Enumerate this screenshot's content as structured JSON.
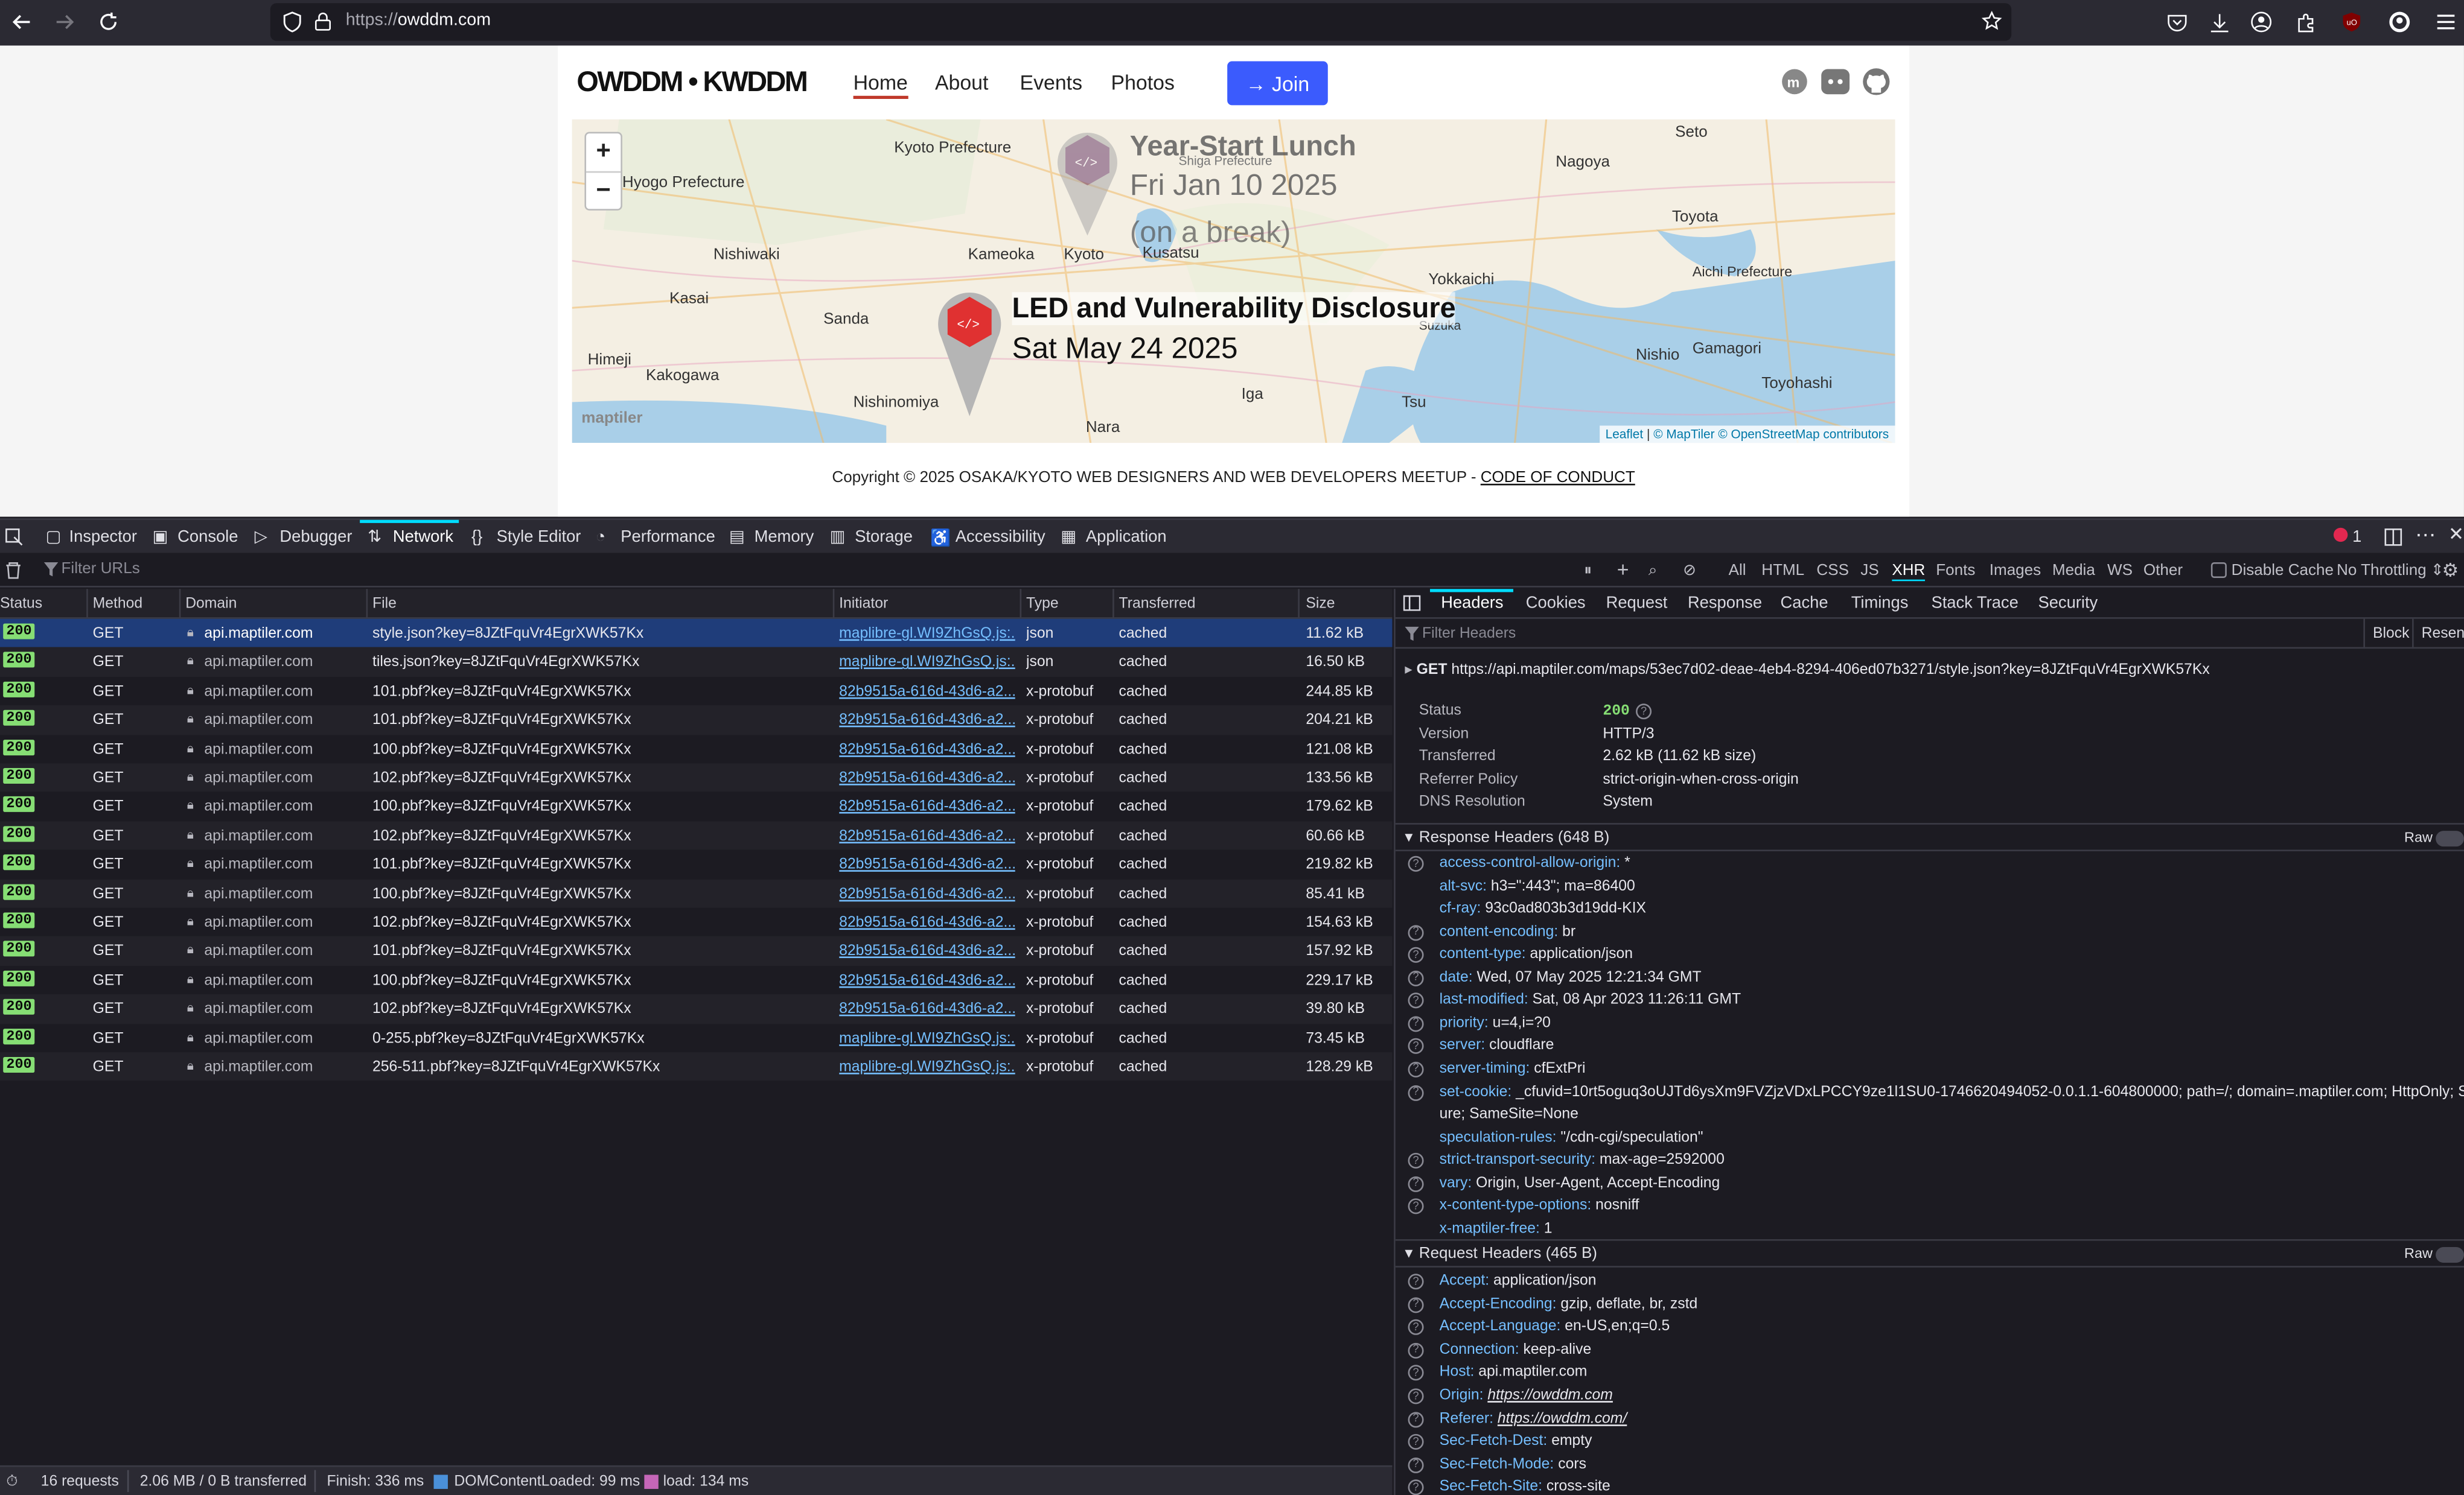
{
  "browser": {
    "url_scheme": "https://",
    "url_host": "owddm.com"
  },
  "site": {
    "logo": "OWDDM • KWDDM",
    "nav": [
      "Home",
      "About",
      "Events",
      "Photos"
    ],
    "join": "→ Join",
    "map": {
      "cities": [
        "Seto",
        "Kyoto Prefecture",
        "Hyogo Prefecture",
        "Shiga Prefecture",
        "Nagoya",
        "Toyota",
        "Nishiwaki",
        "Kameoka",
        "Kyoto",
        "Kusatsu",
        "Yokkaichi",
        "Aichi Prefecture",
        "Kasai",
        "Sanda",
        "Suzuka",
        "Himeji",
        "Kakogawa",
        "Nishio",
        "Gamagori",
        "Toyohashi",
        "Nishinomiya",
        "Iga",
        "Tsu",
        "Nara"
      ],
      "event1": {
        "title": "Year-Start Lunch",
        "date": "Fri Jan 10 2025",
        "note": "(on a break)"
      },
      "event2": {
        "title": "LED and Vulnerability Disclosure",
        "date": "Sat May 24 2025"
      },
      "attribution": {
        "leaflet": "Leaflet",
        "sep": " | ",
        "maptiler": "© MapTiler",
        "osm": "© OpenStreetMap contributors"
      },
      "maptiler_logo": "maptiler"
    },
    "copyright": "Copyright © 2025 OSAKA/KYOTO WEB DESIGNERS AND WEB DEVELOPERS MEETUP - ",
    "code_of_conduct": "CODE OF CONDUCT"
  },
  "devtools": {
    "tabs": [
      "Inspector",
      "Console",
      "Debugger",
      "Network",
      "Style Editor",
      "Performance",
      "Memory",
      "Storage",
      "Accessibility",
      "Application"
    ],
    "error_count": "1",
    "filter_placeholder": "Filter URLs",
    "types": [
      "All",
      "HTML",
      "CSS",
      "JS",
      "XHR",
      "Fonts",
      "Images",
      "Media",
      "WS",
      "Other"
    ],
    "disable_cache": "Disable Cache",
    "throttling": "No Throttling ⇕",
    "columns": [
      "Status",
      "Method",
      "Domain",
      "File",
      "Initiator",
      "Type",
      "Transferred",
      "Size"
    ],
    "requests": [
      {
        "status": "200",
        "method": "GET",
        "domain": "api.maptiler.com",
        "file": "style.json?key=8JZtFquVr4EgrXWK57Kx",
        "initiator": "maplibre-gl.WI9ZhGsQ.js:...",
        "type": "json",
        "transferred": "cached",
        "size": "11.62 kB"
      },
      {
        "status": "200",
        "method": "GET",
        "domain": "api.maptiler.com",
        "file": "tiles.json?key=8JZtFquVr4EgrXWK57Kx",
        "initiator": "maplibre-gl.WI9ZhGsQ.js:...",
        "type": "json",
        "transferred": "cached",
        "size": "16.50 kB"
      },
      {
        "status": "200",
        "method": "GET",
        "domain": "api.maptiler.com",
        "file": "101.pbf?key=8JZtFquVr4EgrXWK57Kx",
        "initiator": "82b9515a-616d-43d6-a2...",
        "type": "x-protobuf",
        "transferred": "cached",
        "size": "244.85 kB"
      },
      {
        "status": "200",
        "method": "GET",
        "domain": "api.maptiler.com",
        "file": "101.pbf?key=8JZtFquVr4EgrXWK57Kx",
        "initiator": "82b9515a-616d-43d6-a2...",
        "type": "x-protobuf",
        "transferred": "cached",
        "size": "204.21 kB"
      },
      {
        "status": "200",
        "method": "GET",
        "domain": "api.maptiler.com",
        "file": "100.pbf?key=8JZtFquVr4EgrXWK57Kx",
        "initiator": "82b9515a-616d-43d6-a2...",
        "type": "x-protobuf",
        "transferred": "cached",
        "size": "121.08 kB"
      },
      {
        "status": "200",
        "method": "GET",
        "domain": "api.maptiler.com",
        "file": "102.pbf?key=8JZtFquVr4EgrXWK57Kx",
        "initiator": "82b9515a-616d-43d6-a2...",
        "type": "x-protobuf",
        "transferred": "cached",
        "size": "133.56 kB"
      },
      {
        "status": "200",
        "method": "GET",
        "domain": "api.maptiler.com",
        "file": "100.pbf?key=8JZtFquVr4EgrXWK57Kx",
        "initiator": "82b9515a-616d-43d6-a2...",
        "type": "x-protobuf",
        "transferred": "cached",
        "size": "179.62 kB"
      },
      {
        "status": "200",
        "method": "GET",
        "domain": "api.maptiler.com",
        "file": "102.pbf?key=8JZtFquVr4EgrXWK57Kx",
        "initiator": "82b9515a-616d-43d6-a2...",
        "type": "x-protobuf",
        "transferred": "cached",
        "size": "60.66 kB"
      },
      {
        "status": "200",
        "method": "GET",
        "domain": "api.maptiler.com",
        "file": "101.pbf?key=8JZtFquVr4EgrXWK57Kx",
        "initiator": "82b9515a-616d-43d6-a2...",
        "type": "x-protobuf",
        "transferred": "cached",
        "size": "219.82 kB"
      },
      {
        "status": "200",
        "method": "GET",
        "domain": "api.maptiler.com",
        "file": "100.pbf?key=8JZtFquVr4EgrXWK57Kx",
        "initiator": "82b9515a-616d-43d6-a2...",
        "type": "x-protobuf",
        "transferred": "cached",
        "size": "85.41 kB"
      },
      {
        "status": "200",
        "method": "GET",
        "domain": "api.maptiler.com",
        "file": "102.pbf?key=8JZtFquVr4EgrXWK57Kx",
        "initiator": "82b9515a-616d-43d6-a2...",
        "type": "x-protobuf",
        "transferred": "cached",
        "size": "154.63 kB"
      },
      {
        "status": "200",
        "method": "GET",
        "domain": "api.maptiler.com",
        "file": "101.pbf?key=8JZtFquVr4EgrXWK57Kx",
        "initiator": "82b9515a-616d-43d6-a2...",
        "type": "x-protobuf",
        "transferred": "cached",
        "size": "157.92 kB"
      },
      {
        "status": "200",
        "method": "GET",
        "domain": "api.maptiler.com",
        "file": "100.pbf?key=8JZtFquVr4EgrXWK57Kx",
        "initiator": "82b9515a-616d-43d6-a2...",
        "type": "x-protobuf",
        "transferred": "cached",
        "size": "229.17 kB"
      },
      {
        "status": "200",
        "method": "GET",
        "domain": "api.maptiler.com",
        "file": "102.pbf?key=8JZtFquVr4EgrXWK57Kx",
        "initiator": "82b9515a-616d-43d6-a2...",
        "type": "x-protobuf",
        "transferred": "cached",
        "size": "39.80 kB"
      },
      {
        "status": "200",
        "method": "GET",
        "domain": "api.maptiler.com",
        "file": "0-255.pbf?key=8JZtFquVr4EgrXWK57Kx",
        "initiator": "maplibre-gl.WI9ZhGsQ.js:...",
        "type": "x-protobuf",
        "transferred": "cached",
        "size": "73.45 kB"
      },
      {
        "status": "200",
        "method": "GET",
        "domain": "api.maptiler.com",
        "file": "256-511.pbf?key=8JZtFquVr4EgrXWK57Kx",
        "initiator": "maplibre-gl.WI9ZhGsQ.js:...",
        "type": "x-protobuf",
        "transferred": "cached",
        "size": "128.29 kB"
      }
    ],
    "panel_tabs": [
      "Headers",
      "Cookies",
      "Request",
      "Response",
      "Cache",
      "Timings",
      "Stack Trace",
      "Security"
    ],
    "filter_headers": "Filter Headers",
    "block": "Block",
    "resend": "Resend",
    "request_line": {
      "method": "GET",
      "url": "https://api.maptiler.com/maps/53ec7d02-deae-4eb4-8294-406ed07b3271/style.json?key=8JZtFquVr4EgrXWK57Kx"
    },
    "summary": [
      {
        "k": "Status",
        "v": "200"
      },
      {
        "k": "Version",
        "v": "HTTP/3"
      },
      {
        "k": "Transferred",
        "v": "2.62 kB (11.62 kB size)"
      },
      {
        "k": "Referrer Policy",
        "v": "strict-origin-when-cross-origin"
      },
      {
        "k": "DNS Resolution",
        "v": "System"
      }
    ],
    "response_headers_title": "Response Headers (648 B)",
    "raw": "Raw",
    "response_headers": [
      {
        "k": "access-control-allow-origin:",
        "v": "*",
        "q": true
      },
      {
        "k": "alt-svc:",
        "v": "h3=\":443\"; ma=86400",
        "q": false
      },
      {
        "k": "cf-ray:",
        "v": "93c0ad803b3d19dd-KIX",
        "q": false
      },
      {
        "k": "content-encoding:",
        "v": "br",
        "q": true
      },
      {
        "k": "content-type:",
        "v": "application/json",
        "q": true
      },
      {
        "k": "date:",
        "v": "Wed, 07 May 2025 12:21:34 GMT",
        "q": true
      },
      {
        "k": "last-modified:",
        "v": "Sat, 08 Apr 2023 11:26:11 GMT",
        "q": true
      },
      {
        "k": "priority:",
        "v": "u=4,i=?0",
        "q": true
      },
      {
        "k": "server:",
        "v": "cloudflare",
        "q": true
      },
      {
        "k": "server-timing:",
        "v": "cfExtPri",
        "q": true
      },
      {
        "k": "set-cookie:",
        "v": "_cfuvid=10rt5oguq3oUJTd6ysXm9FVZjzVDxLPCCY9ze1l1SU0-1746620494052-0.0.1.1-604800000; path=/; domain=.maptiler.com; HttpOnly; Sec",
        "q": true
      },
      {
        "k": "",
        "v": "ure; SameSite=None",
        "q": false
      },
      {
        "k": "speculation-rules:",
        "v": "\"/cdn-cgi/speculation\"",
        "q": false
      },
      {
        "k": "strict-transport-security:",
        "v": "max-age=2592000",
        "q": true
      },
      {
        "k": "vary:",
        "v": "Origin, User-Agent, Accept-Encoding",
        "q": true
      },
      {
        "k": "x-content-type-options:",
        "v": "nosniff",
        "q": true
      },
      {
        "k": "x-maptiler-free:",
        "v": "1",
        "q": false
      }
    ],
    "request_headers_title": "Request Headers (465 B)",
    "request_headers": [
      {
        "k": "Accept:",
        "v": "application/json"
      },
      {
        "k": "Accept-Encoding:",
        "v": "gzip, deflate, br, zstd"
      },
      {
        "k": "Accept-Language:",
        "v": "en-US,en;q=0.5"
      },
      {
        "k": "Connection:",
        "v": "keep-alive"
      },
      {
        "k": "Host:",
        "v": "api.maptiler.com"
      },
      {
        "k": "Origin:",
        "v": "https://owddm.com"
      },
      {
        "k": "Referer:",
        "v": "https://owddm.com/"
      },
      {
        "k": "Sec-Fetch-Dest:",
        "v": "empty"
      },
      {
        "k": "Sec-Fetch-Mode:",
        "v": "cors"
      },
      {
        "k": "Sec-Fetch-Site:",
        "v": "cross-site"
      }
    ],
    "status_bar": {
      "requests": "16 requests",
      "transferred": "2.06 MB / 0 B transferred",
      "finish": "Finish: 336 ms",
      "dcl": "DOMContentLoaded: 99 ms",
      "load": "load: 134 ms"
    }
  },
  "colors": {
    "status_ok": "#86de74",
    "accent": "#00ddff",
    "join": "#3b5bfd",
    "link": "#75bfff"
  }
}
